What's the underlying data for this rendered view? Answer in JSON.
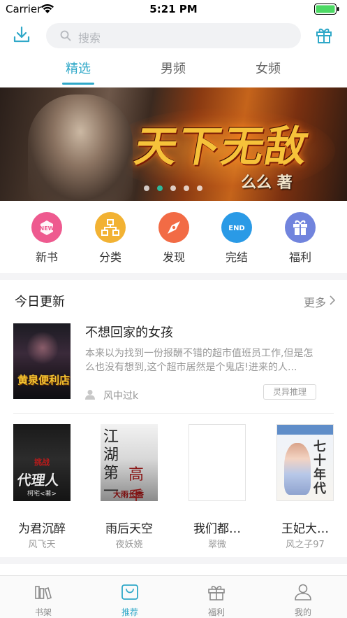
{
  "status_bar": {
    "carrier": "Carrier",
    "time": "5:21 PM"
  },
  "search": {
    "placeholder": "搜索"
  },
  "tabs": [
    {
      "label": "精选",
      "active": true
    },
    {
      "label": "男频",
      "active": false
    },
    {
      "label": "女频",
      "active": false
    }
  ],
  "banner": {
    "title": "天下无敌",
    "author": "么么 著",
    "slide_count": 5,
    "active_slide": 2
  },
  "categories": [
    {
      "label": "新书",
      "icon": "new-icon",
      "badge": "NEW",
      "color": "#ee5a8f"
    },
    {
      "label": "分类",
      "icon": "category-icon",
      "color": "#f2b233"
    },
    {
      "label": "发现",
      "icon": "compass-icon",
      "color": "#f26b45"
    },
    {
      "label": "完结",
      "icon": "end-icon",
      "badge": "END",
      "color": "#2a9ae6"
    },
    {
      "label": "福利",
      "icon": "gift-icon",
      "color": "#7184dd"
    }
  ],
  "today_updates": {
    "title": "今日更新",
    "more_label": "更多",
    "featured": {
      "title": "不想回家的女孩",
      "description": "本来以为找到一份报酬不错的超市值班员工作,但是怎么也没有想到,这个超市居然是个鬼店!进来的人...",
      "author": "风中过k",
      "genre": "灵异推理",
      "cover_text": "黄泉便利店"
    },
    "books": [
      {
        "title": "为君沉醉",
        "author": "风飞天",
        "cover_text": "代理人",
        "cover_sub": "挑战",
        "cover_author": "柯宅<著>"
      },
      {
        "title": "雨后天空",
        "author": "夜妖娆",
        "cover_text": "江湖第一",
        "cover_sub": "高手",
        "cover_author": "大雨长香"
      },
      {
        "title": "我们都…",
        "author": "翠微",
        "cover_text": ""
      },
      {
        "title": "王妃大…",
        "author": "风之子97",
        "cover_text": "七十年代"
      }
    ]
  },
  "tab_bar": [
    {
      "label": "书架",
      "icon": "bookshelf-icon",
      "active": false
    },
    {
      "label": "推荐",
      "icon": "recommend-icon",
      "active": true
    },
    {
      "label": "福利",
      "icon": "gift-icon",
      "active": false
    },
    {
      "label": "我的",
      "icon": "profile-icon",
      "active": false
    }
  ],
  "colors": {
    "accent": "#2fa8c8",
    "banner_dot_active": "#2fb89b"
  }
}
